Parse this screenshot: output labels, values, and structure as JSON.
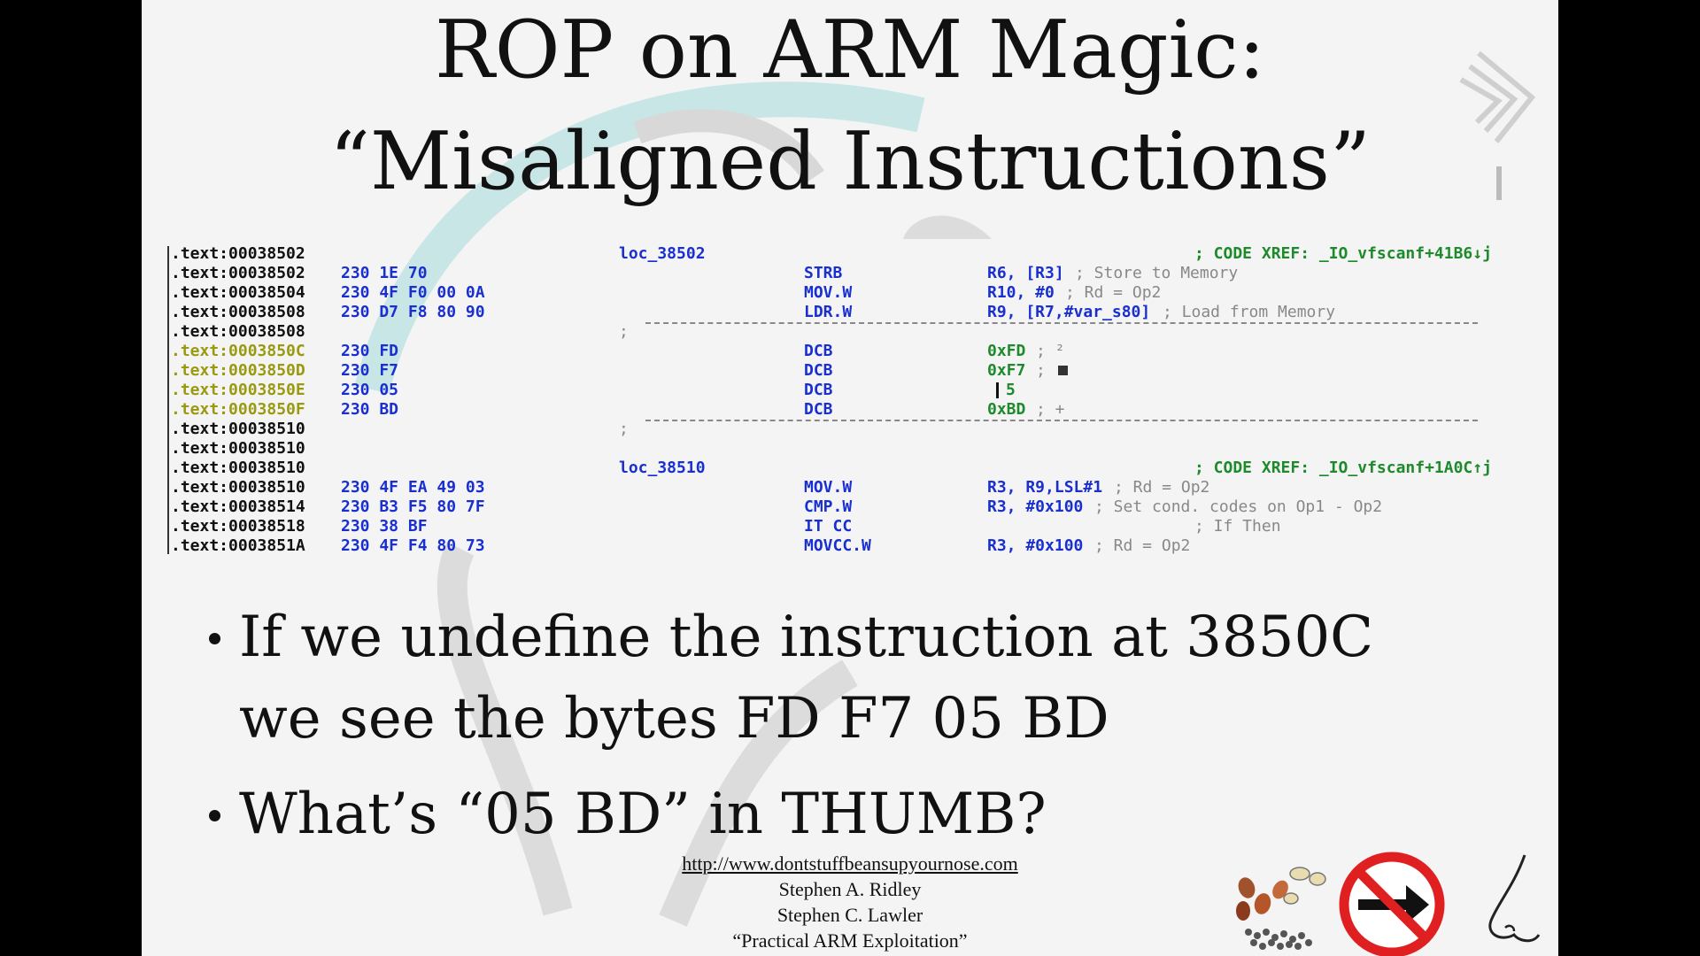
{
  "slide": {
    "title_line1": "ROP on ARM Magic:",
    "title_line2": "“Misaligned Instructions”",
    "code": [
      {
        "addr": ".text:00038502",
        "bytes": "",
        "label": "loc_38502",
        "mnem": "",
        "ops": "",
        "cmt": "",
        "xref": "; CODE XREF: _IO_vfscanf+41B6↓j"
      },
      {
        "addr": ".text:00038502",
        "bytes": "230 1E 70",
        "label": "",
        "mnem": "STRB",
        "ops": "R6, [R3]",
        "cmt": "; Store to Memory",
        "xref": ""
      },
      {
        "addr": ".text:00038504",
        "bytes": "230 4F F0 00 0A",
        "label": "",
        "mnem": "MOV.W",
        "ops": "R10, #0",
        "cmt": "; Rd = Op2",
        "xref": ""
      },
      {
        "addr": ".text:00038508",
        "bytes": "230 D7 F8 80 90",
        "label": "",
        "mnem": "LDR.W",
        "ops": "R9, [R7,#var_s80]",
        "cmt": "; Load from Memory",
        "xref": ""
      },
      {
        "addr": ".text:00038508",
        "bytes": "",
        "label": "",
        "mnem": "",
        "ops": "",
        "cmt": "",
        "xref": "",
        "sep": ";"
      },
      {
        "addr": ".text:0003850C",
        "bytes": "230 FD",
        "label": "",
        "mnem": "DCB",
        "ops": "0xFD",
        "cmt": "; ²",
        "xref": "",
        "hl": true
      },
      {
        "addr": ".text:0003850D",
        "bytes": "230 F7",
        "label": "",
        "mnem": "DCB",
        "ops": "0xF7",
        "cmt": ";",
        "xref": "",
        "hl": true,
        "sq": true
      },
      {
        "addr": ".text:0003850E",
        "bytes": "230 05",
        "label": "",
        "mnem": "DCB",
        "ops": "5",
        "cmt": "",
        "xref": "",
        "hl": true,
        "cursor": true
      },
      {
        "addr": ".text:0003850F",
        "bytes": "230 BD",
        "label": "",
        "mnem": "DCB",
        "ops": "0xBD",
        "cmt": "; +",
        "xref": "",
        "hl": true
      },
      {
        "addr": ".text:00038510",
        "bytes": "",
        "label": "",
        "mnem": "",
        "ops": "",
        "cmt": "",
        "xref": "",
        "sep": ";"
      },
      {
        "addr": ".text:00038510",
        "bytes": "",
        "label": "",
        "mnem": "",
        "ops": "",
        "cmt": "",
        "xref": ""
      },
      {
        "addr": ".text:00038510",
        "bytes": "",
        "label": "loc_38510",
        "mnem": "",
        "ops": "",
        "cmt": "",
        "xref": "; CODE XREF: _IO_vfscanf+1A0C↑j"
      },
      {
        "addr": ".text:00038510",
        "bytes": "230 4F EA 49 03",
        "label": "",
        "mnem": "MOV.W",
        "ops": "R3, R9,LSL#1",
        "cmt": "; Rd = Op2",
        "xref": ""
      },
      {
        "addr": ".text:00038514",
        "bytes": "230 B3 F5 80 7F",
        "label": "",
        "mnem": "CMP.W",
        "ops": "R3, #0x100",
        "cmt": "; Set cond. codes on Op1 - Op2",
        "xref": ""
      },
      {
        "addr": ".text:00038518",
        "bytes": "230 38 BF",
        "label": "",
        "mnem": "IT CC",
        "ops": "",
        "cmt": "",
        "xref": "; If Then"
      },
      {
        "addr": ".text:0003851A",
        "bytes": "230 4F F4 80 73",
        "label": "",
        "mnem": "MOVCC.W",
        "ops": "R3, #0x100",
        "cmt": "; Rd = Op2",
        "xref": ""
      }
    ],
    "bullets": [
      "If we undefine the instruction at 3850C",
      "we see the bytes FD F7 05 BD",
      "What’s “05 BD” in THUMB?"
    ],
    "footer": {
      "url": "http://www.dontstuffbeansupyournose.com",
      "author1": "Stephen A. Ridley",
      "author2": "Stephen C. Lawler",
      "talk": "“Practical ARM Exploitation”"
    },
    "icons": [
      "beans-icon",
      "no-entry-arrow-icon",
      "nose-icon",
      "conference-logo-icon"
    ],
    "colors": {
      "background": "#f4f4f4",
      "code_blue": "#1a2fd0",
      "code_green": "#1e8a2c",
      "code_yellow": "#9a9a10",
      "no_sign_red": "#e02020"
    }
  }
}
